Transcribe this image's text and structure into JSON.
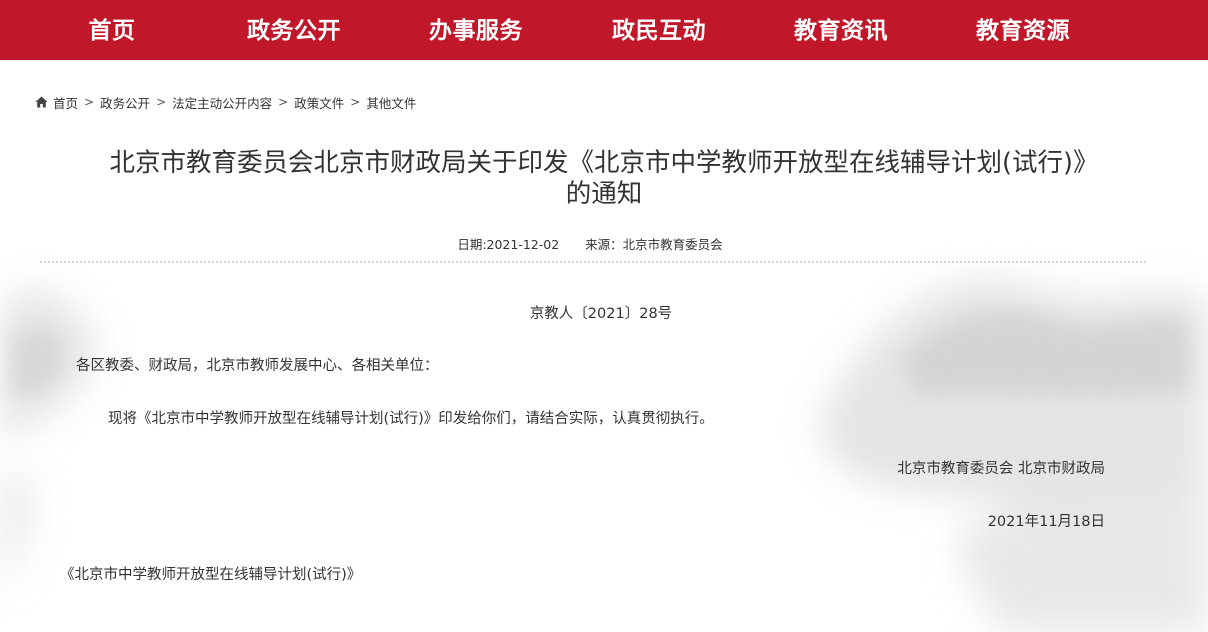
{
  "nav": {
    "items": [
      "首页",
      "政务公开",
      "办事服务",
      "政民互动",
      "教育资讯",
      "教育资源"
    ]
  },
  "breadcrumb": {
    "items": [
      "首页",
      "政务公开",
      "法定主动公开内容",
      "政策文件",
      "其他文件"
    ],
    "separator": ">"
  },
  "article": {
    "title_line1": "北京市教育委员会北京市财政局关于印发《北京市中学教师开放型在线辅导计划(试行)》",
    "title_line2": "的通知",
    "date_label": "日期:2021-12-02",
    "source_label": "来源：北京市教育委员会",
    "doc_number": "京教人〔2021〕28号",
    "addressee": "各区教委、财政局，北京市教师发展中心、各相关单位：",
    "paragraph": "现将《北京市中学教师开放型在线辅导计划(试行)》印发给你们，请结合实际，认真贯彻执行。",
    "signature_org": "北京市教育委员会 北京市财政局",
    "signature_date": "2021年11月18日",
    "attachment_link": "《北京市中学教师开放型在线辅导计划(试行)》"
  },
  "colors": {
    "nav_bg": "#c0182a",
    "text": "#333333"
  }
}
